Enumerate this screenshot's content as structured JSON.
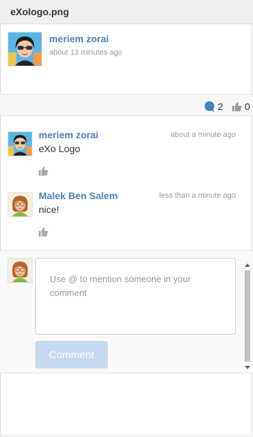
{
  "window": {
    "title": "eXologo.png"
  },
  "activity": {
    "author": "meriem zorai",
    "time": "about 13 minutes ago"
  },
  "stats": {
    "comments_count": "2",
    "likes_count": "0"
  },
  "comments": [
    {
      "author": "meriem zorai",
      "time": "about a minute ago",
      "text": "eXo Logo"
    },
    {
      "author": "Malek Ben Salem",
      "time": "less than a minute ago",
      "text": "nice!"
    }
  ],
  "composer": {
    "placeholder": "Use @ to mention someone in your comment",
    "value": "",
    "button_label": "Comment"
  },
  "colors": {
    "link": "#4a7fb8",
    "accent_icon": "#4a7fb8",
    "button_disabled": "#c6d9ef"
  },
  "icons": {
    "comment": "comment-bubble-icon",
    "like": "thumbs-up-icon"
  }
}
